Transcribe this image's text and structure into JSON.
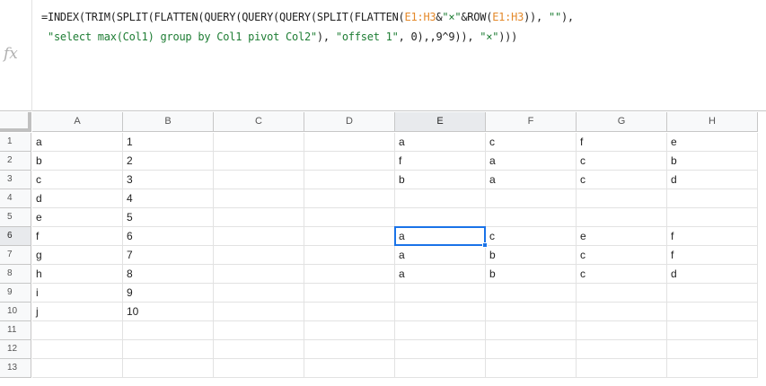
{
  "formula_bar": {
    "fx_label": "fx",
    "line1": [
      {
        "t": "=INDEX(TRIM(SPLIT(FLATTEN(QUERY(QUERY(QUERY(SPLIT(FLATTEN(",
        "c": "n"
      },
      {
        "t": "E1:H3",
        "c": "r"
      },
      {
        "t": "&",
        "c": "n"
      },
      {
        "t": "\"×\"",
        "c": "s"
      },
      {
        "t": "&ROW(",
        "c": "n"
      },
      {
        "t": "E1:H3",
        "c": "r"
      },
      {
        "t": ")), ",
        "c": "n"
      },
      {
        "t": "\"\"",
        "c": "s"
      },
      {
        "t": "),",
        "c": "n"
      }
    ],
    "line2": [
      {
        "t": " ",
        "c": "n"
      },
      {
        "t": "\"select max(Col1) group by Col1 pivot Col2\"",
        "c": "s"
      },
      {
        "t": "), ",
        "c": "n"
      },
      {
        "t": "\"offset 1\"",
        "c": "s"
      },
      {
        "t": ", 0),,9^9)), ",
        "c": "n"
      },
      {
        "t": "\"×\"",
        "c": "s"
      },
      {
        "t": ")))",
        "c": "n"
      }
    ]
  },
  "columns": [
    "A",
    "B",
    "C",
    "D",
    "E",
    "F",
    "G",
    "H"
  ],
  "rows": [
    "1",
    "2",
    "3",
    "4",
    "5",
    "6",
    "7",
    "8",
    "9",
    "10",
    "11",
    "12",
    "13"
  ],
  "selected_column": "E",
  "selected_row": "6",
  "active_cell": "E6",
  "cells": [
    [
      "a",
      "1",
      "",
      "",
      "a",
      "c",
      "f",
      "e"
    ],
    [
      "b",
      "2",
      "",
      "",
      "f",
      "a",
      "c",
      "b"
    ],
    [
      "c",
      "3",
      "",
      "",
      "b",
      "a",
      "c",
      "d"
    ],
    [
      "d",
      "4",
      "",
      "",
      "",
      "",
      "",
      ""
    ],
    [
      "e",
      "5",
      "",
      "",
      "",
      "",
      "",
      ""
    ],
    [
      "f",
      "6",
      "",
      "",
      "a",
      "c",
      "e",
      "f"
    ],
    [
      "g",
      "7",
      "",
      "",
      "a",
      "b",
      "c",
      "f"
    ],
    [
      "h",
      "8",
      "",
      "",
      "a",
      "b",
      "c",
      "d"
    ],
    [
      "i",
      "9",
      "",
      "",
      "",
      "",
      "",
      ""
    ],
    [
      "j",
      "10",
      "",
      "",
      "",
      "",
      "",
      ""
    ],
    [
      "",
      "",
      "",
      "",
      "",
      "",
      "",
      ""
    ],
    [
      "",
      "",
      "",
      "",
      "",
      "",
      "",
      ""
    ],
    [
      "",
      "",
      "",
      "",
      "",
      "",
      "",
      ""
    ]
  ]
}
